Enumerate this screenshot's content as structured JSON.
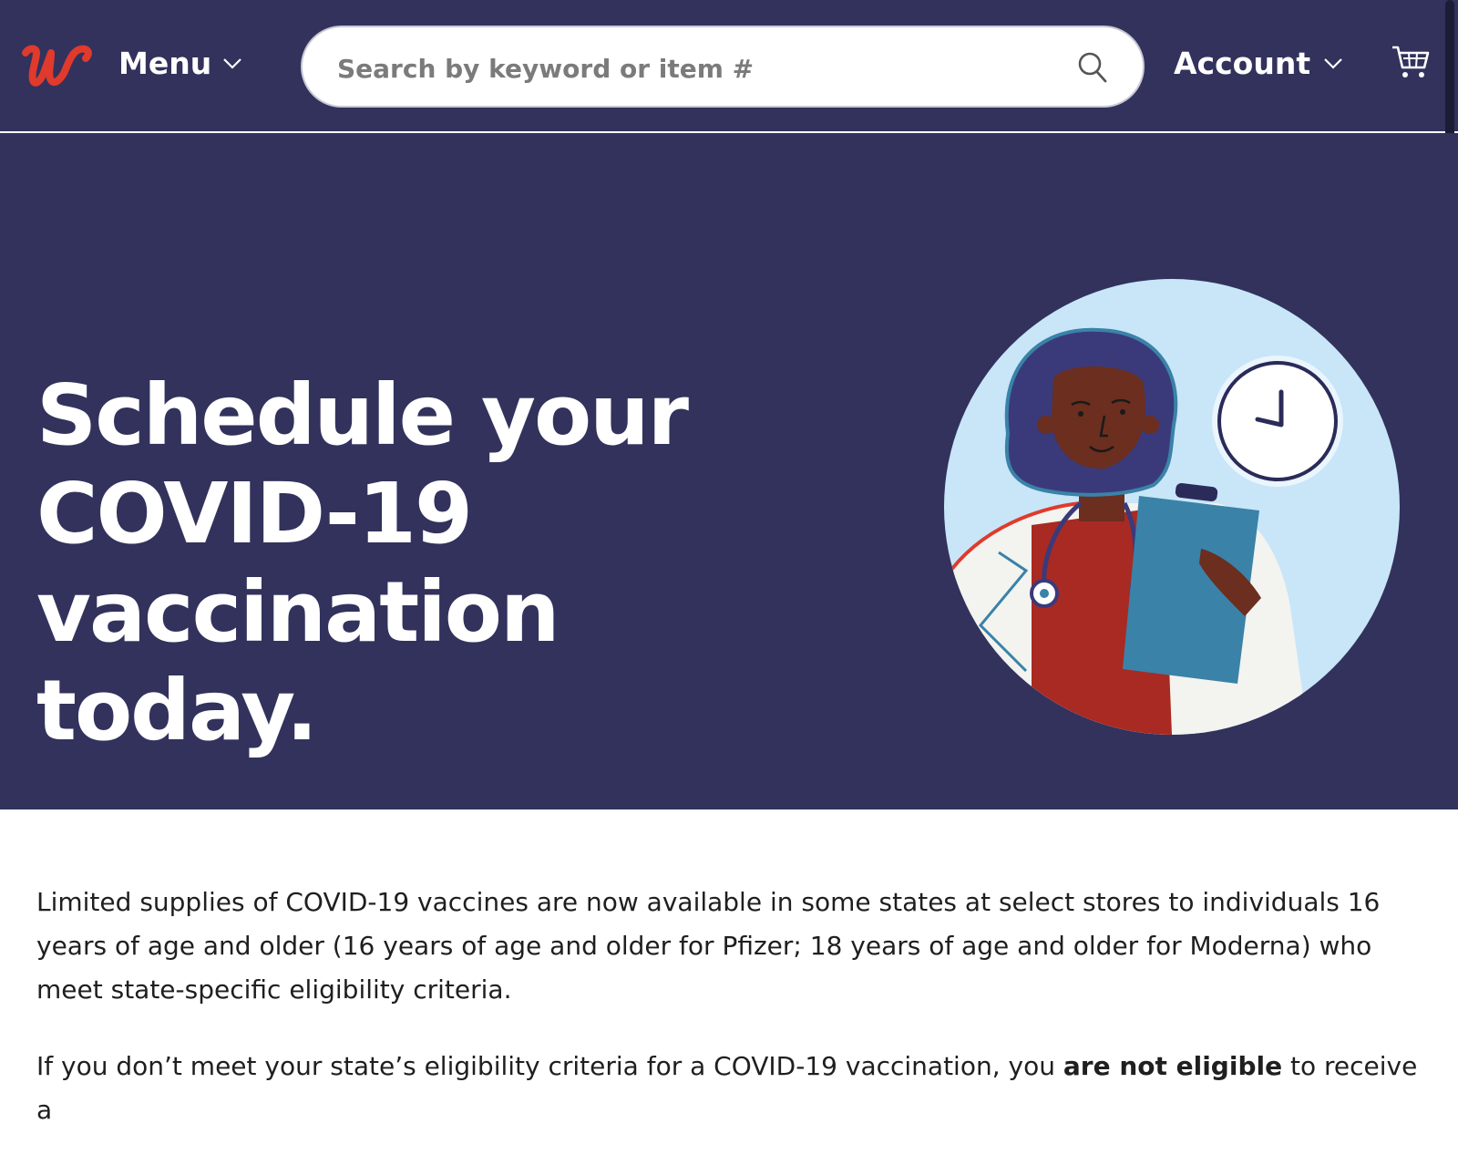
{
  "header": {
    "logo_alt": "Walgreens",
    "menu_label": "Menu",
    "search": {
      "placeholder": "Search by keyword or item #",
      "value": ""
    },
    "account_label": "Account"
  },
  "hero": {
    "title": "Schedule your COVID-19 vaccination today."
  },
  "content": {
    "paragraph_1": "Limited supplies of COVID-19 vaccines are now available in some states at select stores to individuals 16 years of age and older (16 years of age and older for Pfizer; 18 years of age and older for Moderna) who meet state-specific eligibility criteria.",
    "paragraph_2_start": "If you don’t meet your state’s eligibility criteria for a COVID-19 vaccination, you ",
    "paragraph_2_bold": "are not eligible",
    "paragraph_2_end": " to receive a"
  },
  "icons": [
    "walgreens-logo",
    "chevron-down-icon",
    "search-icon",
    "cart-icon"
  ],
  "colors": {
    "header_bg": "#32325d",
    "brand_red": "#e03a2c",
    "text_white": "#ffffff",
    "illustration_sky": "#c8e6f8",
    "clipboard_blue": "#3a82a8",
    "shirt_red": "#a82a23"
  }
}
